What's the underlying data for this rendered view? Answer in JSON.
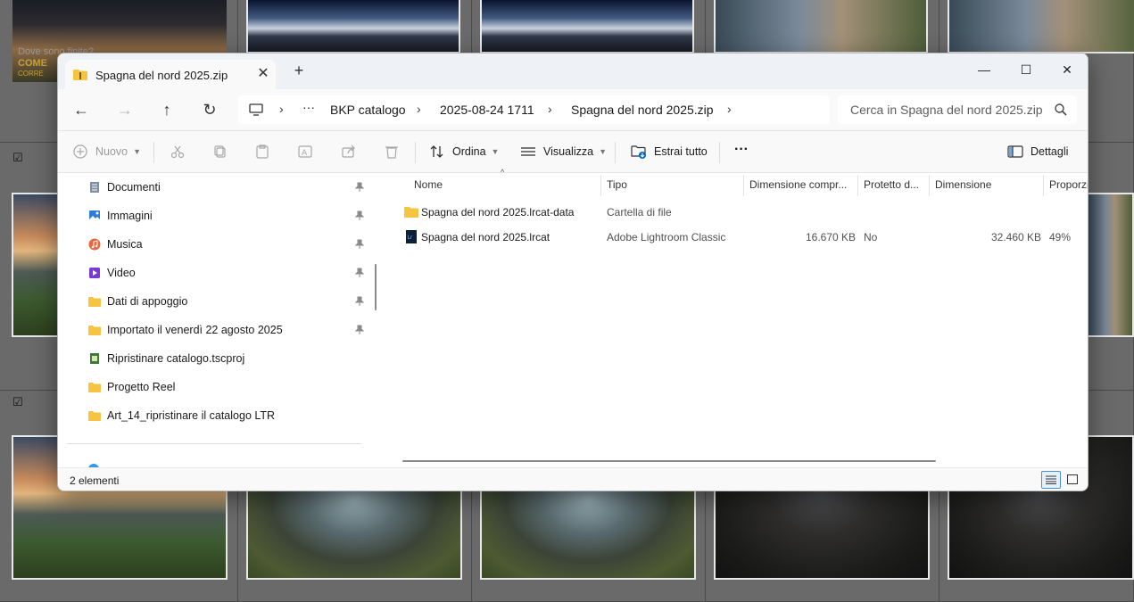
{
  "background": {
    "overlay_text": [
      "Dove sono finite?",
      "COME",
      "CORRE"
    ]
  },
  "window": {
    "tab_title": "Spagna del nord 2025.zip",
    "tab_close": "✕",
    "tab_add": "+",
    "controls": {
      "minimize": "—",
      "maximize": "☐",
      "close": "✕"
    }
  },
  "nav": {
    "back": "←",
    "forward": "→",
    "up": "↑",
    "refresh": "↻",
    "breadcrumb": [
      "BKP catalogo",
      "2025-08-24 1711",
      "Spagna del nord 2025.zip"
    ],
    "more": "···",
    "separator": "›",
    "search_placeholder": "Cerca in Spagna del nord 2025.zip"
  },
  "commands": {
    "new": "Nuovo",
    "sort": "Ordina",
    "view": "Visualizza",
    "extract_all": "Estrai tutto",
    "more": "···",
    "details": "Dettagli"
  },
  "sidebar": {
    "items": [
      {
        "label": "Documenti",
        "icon": "documents-icon",
        "pinned": true
      },
      {
        "label": "Immagini",
        "icon": "pictures-icon",
        "pinned": true
      },
      {
        "label": "Musica",
        "icon": "music-icon",
        "pinned": true
      },
      {
        "label": "Video",
        "icon": "video-icon",
        "pinned": true
      },
      {
        "label": "Dati di appoggio",
        "icon": "folder-icon",
        "pinned": true
      },
      {
        "label": "Importato il venerdì 22 agosto 2025",
        "icon": "folder-icon",
        "pinned": true
      },
      {
        "label": "Ripristinare catalogo.tscproj",
        "icon": "project-file-icon",
        "pinned": false
      },
      {
        "label": "Progetto Reel",
        "icon": "folder-icon",
        "pinned": false
      },
      {
        "label": "Art_14_ripristinare il catalogo LTR",
        "icon": "folder-icon",
        "pinned": false
      }
    ]
  },
  "filelist": {
    "columns": [
      "Nome",
      "Tipo",
      "Dimensione compr...",
      "Protetto d...",
      "Dimensione",
      "Proporzi"
    ],
    "rows": [
      {
        "name": "Spagna del nord 2025.lrcat-data",
        "type": "Cartella di file",
        "compressed": "",
        "protected": "",
        "size": "",
        "ratio": "",
        "icon": "folder-icon"
      },
      {
        "name": "Spagna del nord 2025.lrcat",
        "type": "Adobe Lightroom Classic",
        "compressed": "16.670 KB",
        "protected": "No",
        "size": "32.460 KB",
        "ratio": "49%",
        "icon": "lightroom-catalog-icon"
      }
    ]
  },
  "status": {
    "count": "2 elementi"
  },
  "colors": {
    "accent": "#0067c0",
    "folder": "#f5c542",
    "lightroom": "#0b1f3a"
  }
}
